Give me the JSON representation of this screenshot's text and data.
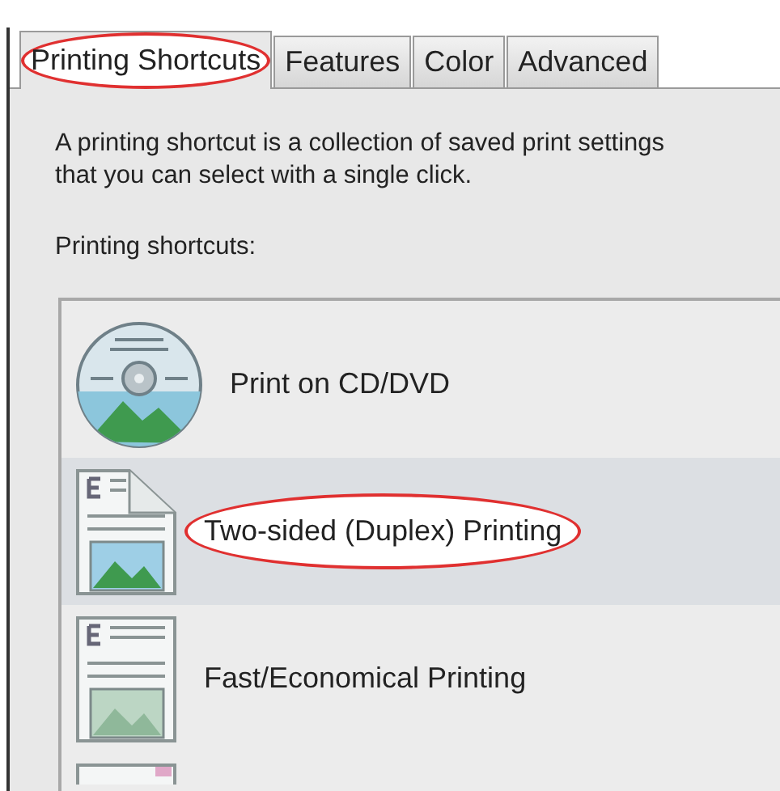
{
  "tabs": [
    {
      "label": "Printing Shortcuts",
      "selected": true,
      "circled": true
    },
    {
      "label": "Features",
      "selected": false,
      "circled": false
    },
    {
      "label": "Color",
      "selected": false,
      "circled": false
    },
    {
      "label": "Advanced",
      "selected": false,
      "circled": false
    }
  ],
  "description": [
    "A printing shortcut is a collection of saved print settings",
    "that you can select with a single click."
  ],
  "list_label": "Printing shortcuts:",
  "shortcuts": [
    {
      "kind": "disc",
      "label": "Print on CD/DVD",
      "selected": false,
      "circled": false
    },
    {
      "kind": "duplex",
      "label": "Two-sided (Duplex) Printing",
      "selected": true,
      "circled": true
    },
    {
      "kind": "document",
      "label": "Fast/Economical Printing",
      "selected": false,
      "circled": false
    },
    {
      "kind": "partial"
    }
  ]
}
